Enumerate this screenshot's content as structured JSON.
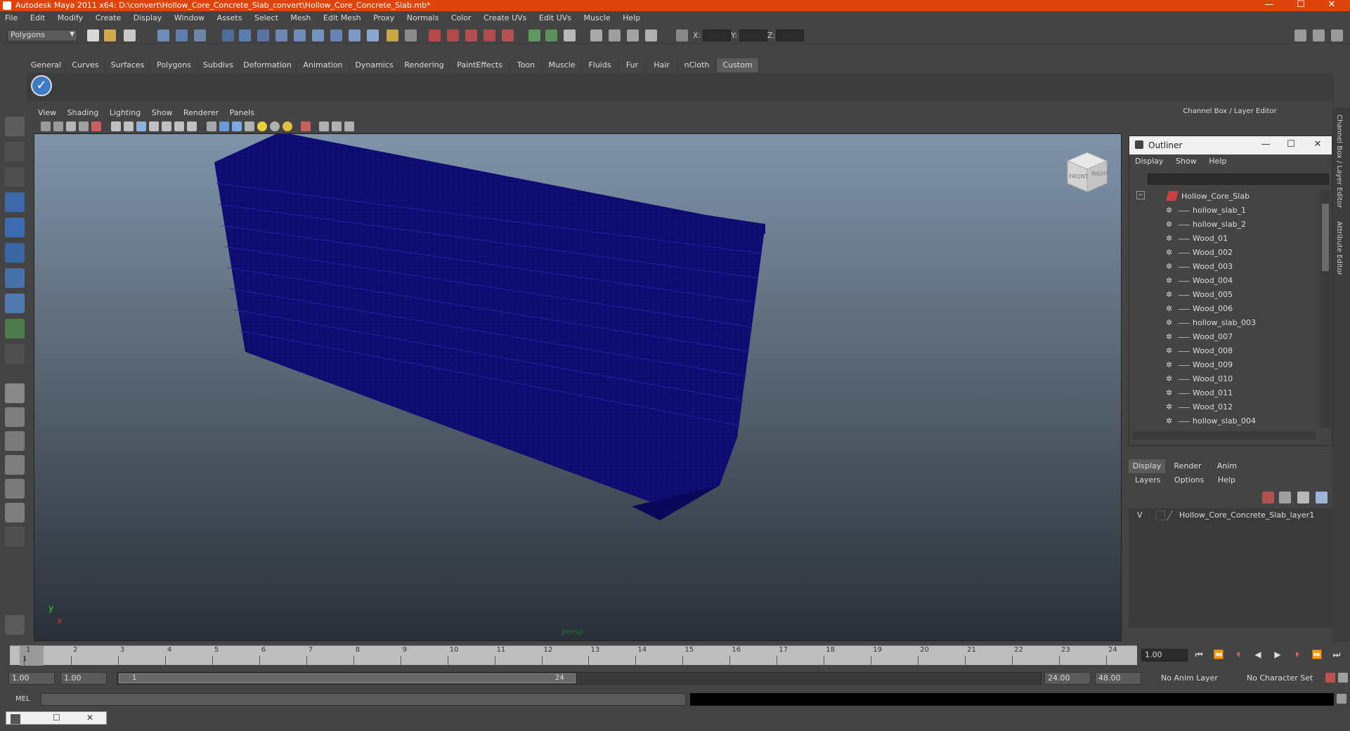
{
  "window": {
    "title": "Autodesk Maya 2011 x64: D:\\convert\\Hollow_Core_Concrete_Slab_convert\\Hollow_Core_Concrete_Slab.mb*",
    "minimize": "—",
    "maximize": "☐",
    "close": "✕"
  },
  "menu": [
    "File",
    "Edit",
    "Modify",
    "Create",
    "Display",
    "Window",
    "Assets",
    "Select",
    "Mesh",
    "Edit Mesh",
    "Proxy",
    "Normals",
    "Color",
    "Create UVs",
    "Edit UVs",
    "Muscle",
    "Help"
  ],
  "status": {
    "mode": "Polygons",
    "x_label": "X:",
    "y_label": "Y:",
    "z_label": "Z:"
  },
  "shelf": {
    "tabs": [
      "General",
      "Curves",
      "Surfaces",
      "Polygons",
      "Subdivs",
      "Deformation",
      "Animation",
      "Dynamics",
      "Rendering",
      "PaintEffects",
      "Toon",
      "Muscle",
      "Fluids",
      "Fur",
      "Hair",
      "nCloth",
      "Custom"
    ],
    "active": "Custom"
  },
  "viewport": {
    "menu": [
      "View",
      "Shading",
      "Lighting",
      "Show",
      "Renderer",
      "Panels"
    ],
    "camera": "persp",
    "cube_front": "FRONT",
    "cube_right": "RIGHT",
    "axis_y": "y",
    "axis_x": "x"
  },
  "dock": {
    "header": "Channel Box / Layer Editor",
    "side_tabs": [
      "Channel Box / Layer Editor",
      "Attribute Editor"
    ]
  },
  "outliner": {
    "title": "Outliner",
    "menu": [
      "Display",
      "Show",
      "Help"
    ],
    "root": "Hollow_Core_Slab",
    "items": [
      "hollow_slab_1",
      "hollow_slab_2",
      "Wood_01",
      "Wood_002",
      "Wood_003",
      "Wood_004",
      "Wood_005",
      "Wood_006",
      "hollow_slab_003",
      "Wood_007",
      "Wood_008",
      "Wood_009",
      "Wood_010",
      "Wood_011",
      "Wood_012",
      "hollow_slab_004"
    ]
  },
  "layer_editor": {
    "tabs": [
      "Display",
      "Render",
      "Anim"
    ],
    "active": "Display",
    "menu": [
      "Layers",
      "Options",
      "Help"
    ],
    "layers": [
      {
        "visible": "V",
        "name": "Hollow_Core_Concrete_Slab_layer1"
      }
    ]
  },
  "timeline": {
    "ticks": [
      "1",
      "2",
      "3",
      "4",
      "5",
      "6",
      "7",
      "8",
      "9",
      "10",
      "11",
      "12",
      "13",
      "14",
      "15",
      "16",
      "17",
      "18",
      "19",
      "20",
      "21",
      "22",
      "23",
      "24"
    ],
    "current_frame": "1",
    "current_frame_field": "1.00"
  },
  "range": {
    "start": "1.00",
    "playback_start": "1.00",
    "thumb_start": "1",
    "thumb_end": "24",
    "playback_end": "24.00",
    "end": "48.00",
    "anim_layer": "No Anim Layer",
    "character_set": "No Character Set"
  },
  "command": {
    "label": "MEL"
  }
}
